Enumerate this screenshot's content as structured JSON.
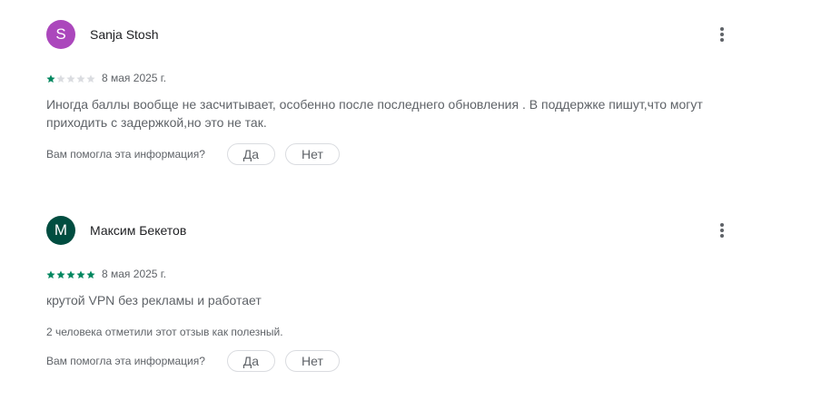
{
  "reviews": [
    {
      "avatar_letter": "S",
      "avatar_color": "#ab47bc",
      "author": "Sanja Stosh",
      "rating": 1,
      "max_rating": 5,
      "date": "8 мая 2025 г.",
      "text": "Иногда баллы вообще не засчитывает, особенно после последнего обновления . В поддержке пишут,что могут приходить с задержкой,но это не так.",
      "helpful_count_text": "",
      "question": "Вам помогла эта информация?",
      "yes_label": "Да",
      "no_label": "Нет",
      "menu_icon": "more-vert-icon"
    },
    {
      "avatar_letter": "M",
      "avatar_color": "#004d40",
      "author": "Максим Бекетов",
      "rating": 5,
      "max_rating": 5,
      "date": "8 мая 2025 г.",
      "text": "крутой VPN без рекламы и работает",
      "helpful_count_text": "2 человека отметили этот отзыв как полезный.",
      "question": "Вам помогла эта информация?",
      "yes_label": "Да",
      "no_label": "Нет",
      "menu_icon": "more-vert-icon"
    }
  ],
  "colors": {
    "star_filled": "#01875f",
    "star_empty": "#dadce0"
  }
}
